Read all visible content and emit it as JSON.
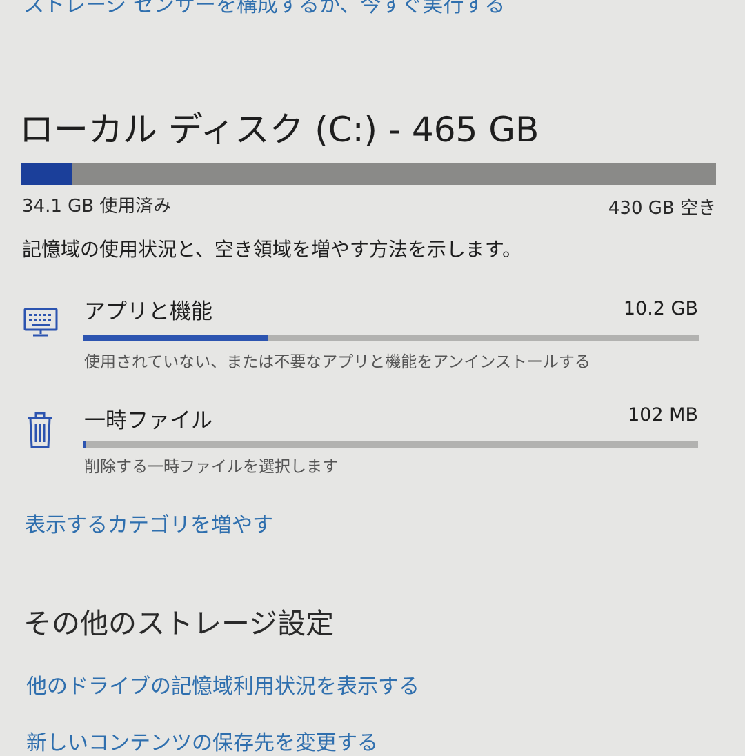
{
  "top_link": "ストレージ センサーを構成するか、今すぐ実行する",
  "drive": {
    "title": "ローカル ディスク (C:) - 465 GB",
    "used_fraction": 0.073,
    "used_label": "34.1 GB 使用済み",
    "free_label": "430 GB 空き",
    "description": "記憶域の使用状況と、空き領域を増やす方法を示します。"
  },
  "categories": [
    {
      "icon": "keyboard-icon",
      "label": "アプリと機能",
      "size": "10.2 GB",
      "fraction": 0.3,
      "description": "使用されていない、または不要なアプリと機能をアンインストールする"
    },
    {
      "icon": "trash-icon",
      "label": "一時ファイル",
      "size": "102 MB",
      "fraction": 0.004,
      "description": "削除する一時ファイルを選択します"
    }
  ],
  "more_categories_link": "表示するカテゴリを増やす",
  "other_settings": {
    "heading": "その他のストレージ設定",
    "links": [
      "他のドライブの記憶域利用状況を表示する",
      "新しいコンテンツの保存先を変更する"
    ]
  },
  "colors": {
    "accent_dark": "#1b3f9a",
    "accent": "#2c54b0",
    "link": "#2f6fae",
    "track": "#8a8a88",
    "track_light": "#b2b2b0"
  }
}
